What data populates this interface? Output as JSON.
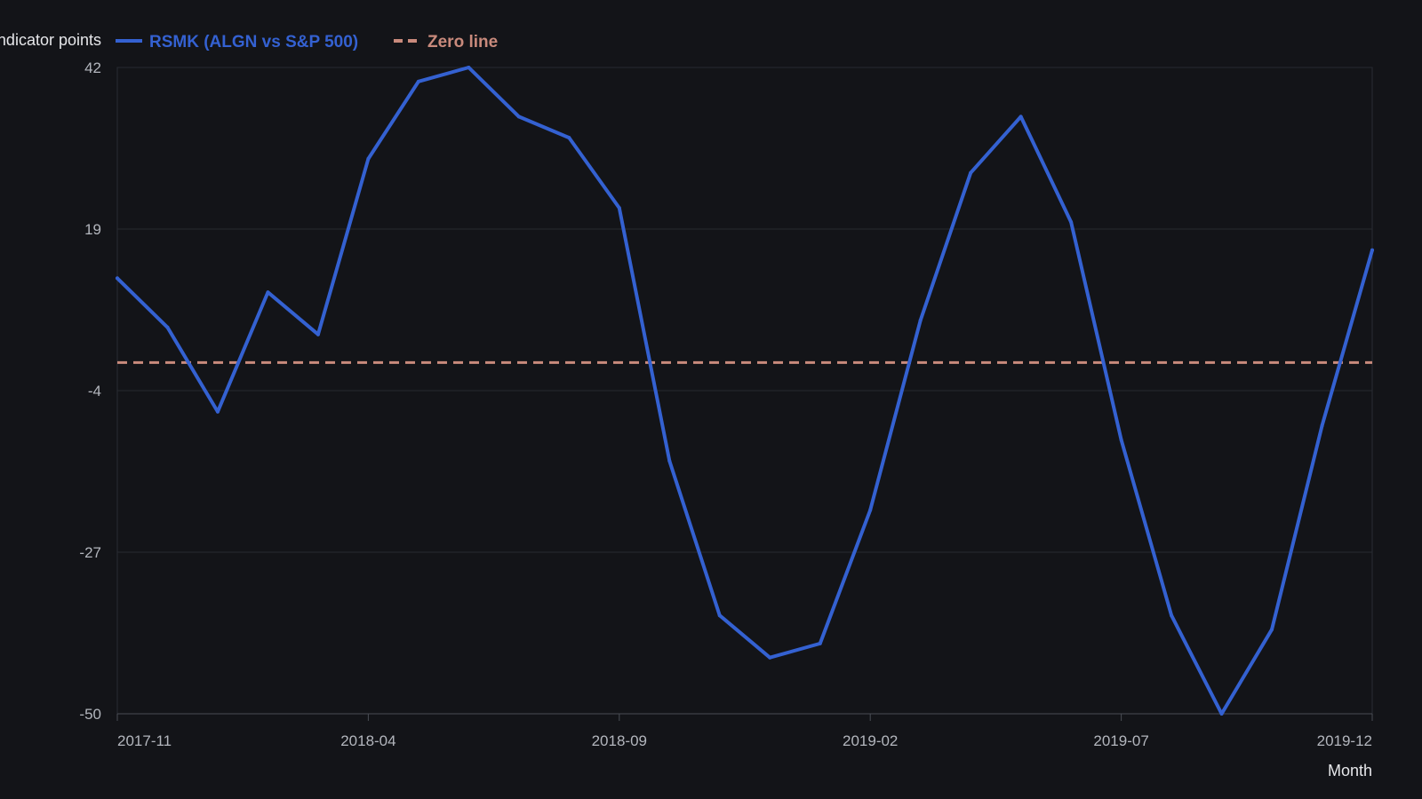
{
  "chart_data": {
    "type": "line",
    "title": "",
    "xlabel": "Month",
    "ylabel": "Indicator points",
    "ylim": [
      -50,
      42
    ],
    "yticks": [
      42,
      19,
      -4,
      -27,
      -50
    ],
    "grid": true,
    "legend_placement": "top-left",
    "x": [
      "2017-11",
      "2017-12",
      "2018-01",
      "2018-02",
      "2018-03",
      "2018-04",
      "2018-05",
      "2018-06",
      "2018-07",
      "2018-08",
      "2018-09",
      "2018-10",
      "2018-11",
      "2018-12",
      "2019-01",
      "2019-02",
      "2019-03",
      "2019-04",
      "2019-05",
      "2019-06",
      "2019-07",
      "2019-08",
      "2019-09",
      "2019-10",
      "2019-11",
      "2019-12"
    ],
    "xticks": [
      "2017-11",
      "2018-04",
      "2018-09",
      "2019-02",
      "2019-07",
      "2019-12"
    ],
    "series": [
      {
        "name": "RSMK (ALGN vs S&P 500)",
        "color": "#3461d1",
        "style": "solid",
        "values": [
          12,
          5,
          -7,
          10,
          4,
          29,
          40,
          42,
          35,
          32,
          22,
          -14,
          -36,
          -42,
          -40,
          -21,
          6,
          27,
          35,
          20,
          -11,
          -36,
          -50,
          -38,
          -9,
          16
        ]
      },
      {
        "name": "Zero line",
        "color": "#c98a7c",
        "style": "dashed",
        "values": [
          0,
          0
        ]
      }
    ]
  }
}
